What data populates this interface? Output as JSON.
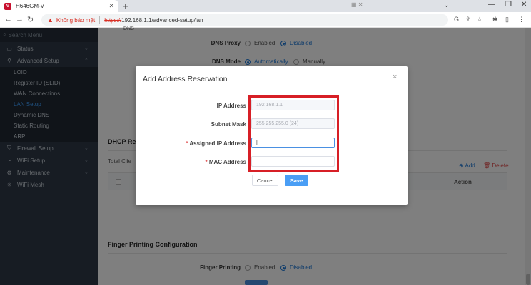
{
  "browser": {
    "tab_title": "H646GM-V",
    "favicon_letter": "V",
    "new_tab": "+",
    "security_warning": "Không bảo mật",
    "url_proto": "https://",
    "url_rest": "192.168.1.1/advanced-setup/lan"
  },
  "sidebar": {
    "search_placeholder": "Search Menu",
    "items": [
      {
        "label": "Status",
        "icon": "monitor-icon"
      },
      {
        "label": "Advanced Setup",
        "icon": "wrench-icon"
      },
      {
        "label": "Firewall Setup",
        "icon": "shield-icon"
      },
      {
        "label": "WiFi Setup",
        "icon": "wifi-icon"
      },
      {
        "label": "Maintenance",
        "icon": "gear-icon"
      },
      {
        "label": "WiFi Mesh",
        "icon": "mesh-icon"
      }
    ],
    "sub_items": [
      "LOID",
      "Register ID (SLID)",
      "WAN Connections",
      "LAN Setup",
      "Dynamic DNS",
      "Static Routing",
      "ARP"
    ]
  },
  "main": {
    "dns_partial": "DNS",
    "dns_proxy_label": "DNS Proxy",
    "dns_proxy_options": [
      "Enabled",
      "Disabled"
    ],
    "dns_mode_label": "DNS Mode",
    "dns_mode_options": [
      "Automatically",
      "Manually"
    ],
    "dhcp_title_partial": "DHCP Re",
    "total_clients_partial": "Total Clie",
    "add_label": "Add",
    "delete_label": "Delete",
    "action_header": "Action",
    "finger_title": "Finger Printing Configuration",
    "finger_label": "Finger Printing",
    "finger_options": [
      "Enabled",
      "Disabled"
    ]
  },
  "modal": {
    "title": "Add Address Reservation",
    "close": "×",
    "ip_label": "IP Address",
    "ip_value": "192.168.1.1",
    "mask_label": "Subnet Mask",
    "mask_value": "255.255.255.0 (24)",
    "assigned_label": "Assigned IP Address",
    "assigned_value": "|",
    "mac_label": "MAC Address",
    "required_mark": "*",
    "cancel": "Cancel",
    "save": "Save"
  },
  "colors": {
    "accent": "#1e78d6",
    "sidebar_bg": "#2e3846",
    "highlight_box": "#d71f26",
    "save_button": "#4a9ef5"
  }
}
